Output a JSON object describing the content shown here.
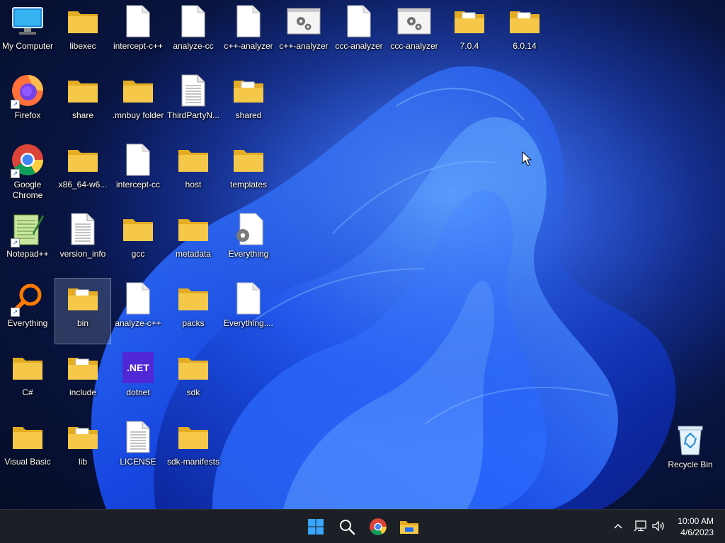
{
  "desktop": {
    "icons": [
      {
        "label": "My Computer",
        "type": "computer"
      },
      {
        "label": "libexec",
        "type": "folder"
      },
      {
        "label": "intercept-c++",
        "type": "file"
      },
      {
        "label": "analyze-cc",
        "type": "file"
      },
      {
        "label": "c++-analyzer",
        "type": "file"
      },
      {
        "label": "c++-analyzer",
        "type": "exe"
      },
      {
        "label": "ccc-analyzer",
        "type": "file"
      },
      {
        "label": "ccc-analyzer",
        "type": "exe"
      },
      {
        "label": "7.0.4",
        "type": "folder-doc"
      },
      {
        "label": "6.0.14",
        "type": "folder-doc"
      },
      {
        "label": "Firefox",
        "type": "firefox",
        "shortcut": true
      },
      {
        "label": "share",
        "type": "folder"
      },
      {
        "label": ".mnbuy folder",
        "type": "folder"
      },
      {
        "label": "ThirdPartyN...",
        "type": "text"
      },
      {
        "label": "shared",
        "type": "folder-doc"
      },
      {
        "label": "Google Chrome",
        "type": "chrome",
        "shortcut": true
      },
      {
        "label": "x86_64-w6...",
        "type": "folder"
      },
      {
        "label": "intercept-cc",
        "type": "file"
      },
      {
        "label": "host",
        "type": "folder"
      },
      {
        "label": "templates",
        "type": "folder"
      },
      {
        "label": "Notepad++",
        "type": "notepadpp",
        "shortcut": true
      },
      {
        "label": "version_info",
        "type": "text"
      },
      {
        "label": "gcc",
        "type": "folder"
      },
      {
        "label": "metadata",
        "type": "folder"
      },
      {
        "label": "Everything",
        "type": "gearfile"
      },
      {
        "label": "Everything",
        "type": "everything",
        "shortcut": true
      },
      {
        "label": "bin",
        "type": "folder-doc",
        "selected": true
      },
      {
        "label": "analyze-c++",
        "type": "file"
      },
      {
        "label": "packs",
        "type": "folder"
      },
      {
        "label": "Everything....",
        "type": "file"
      },
      {
        "label": "C#",
        "type": "folder"
      },
      {
        "label": "include",
        "type": "folder-doc"
      },
      {
        "label": "dotnet",
        "type": "dotnet",
        "badge": ".NET"
      },
      {
        "label": "sdk",
        "type": "folder"
      },
      {
        "label": "Visual Basic",
        "type": "folder"
      },
      {
        "label": "lib",
        "type": "folder-doc"
      },
      {
        "label": "LICENSE",
        "type": "text"
      },
      {
        "label": "sdk-manifests",
        "type": "folder"
      },
      {
        "label": "Recycle Bin",
        "type": "recycle"
      }
    ]
  },
  "taskbar": {
    "pinned": [
      {
        "name": "start-button",
        "icon": "windows-logo-icon"
      },
      {
        "name": "search-button",
        "icon": "search-icon"
      },
      {
        "name": "chrome-taskbar-button",
        "icon": "chrome-icon"
      },
      {
        "name": "file-explorer-taskbar-button",
        "icon": "file-explorer-icon"
      }
    ],
    "clock": {
      "time": "10:00 AM",
      "date": "4/6/2023"
    }
  },
  "colors": {
    "folder": "#f6c84a",
    "folder_dark": "#e4ac22",
    "taskbar": "#1c1f26",
    "dotnet": "#5027d5",
    "accent_blue": "#1a6cff"
  }
}
